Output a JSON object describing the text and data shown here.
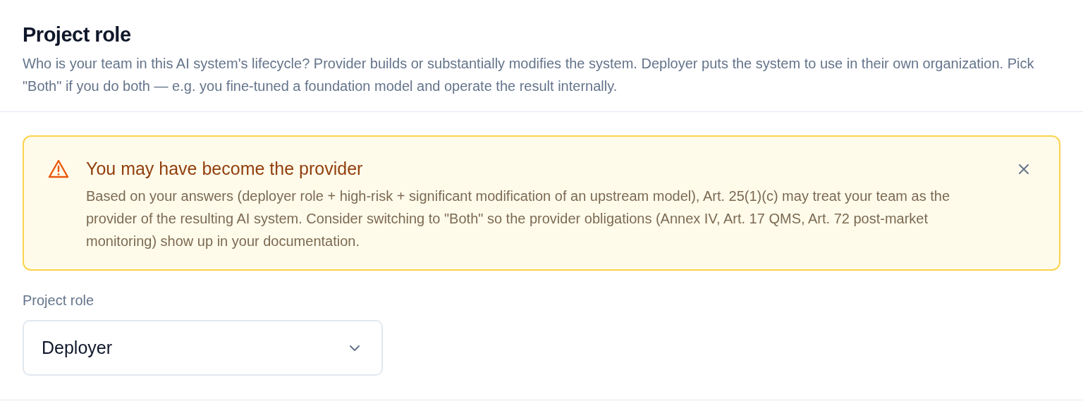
{
  "section": {
    "title": "Project role",
    "description": "Who is your team in this AI system's lifecycle? Provider builds or substantially modifies the system. Deployer puts the system to use in their own organization. Pick \"Both\" if you do both — e.g. you fine-tuned a foundation model and operate the result internally."
  },
  "alert": {
    "title": "You may have become the provider",
    "body": "Based on your answers (deployer role + high-risk + significant modification of an upstream model), Art. 25(1)(c) may treat your team as the provider of the resulting AI system. Consider switching to \"Both\" so the provider obligations (Annex IV, Art. 17 QMS, Art. 72 post-market monitoring) show up in your documentation."
  },
  "field": {
    "label": "Project role",
    "value": "Deployer"
  }
}
